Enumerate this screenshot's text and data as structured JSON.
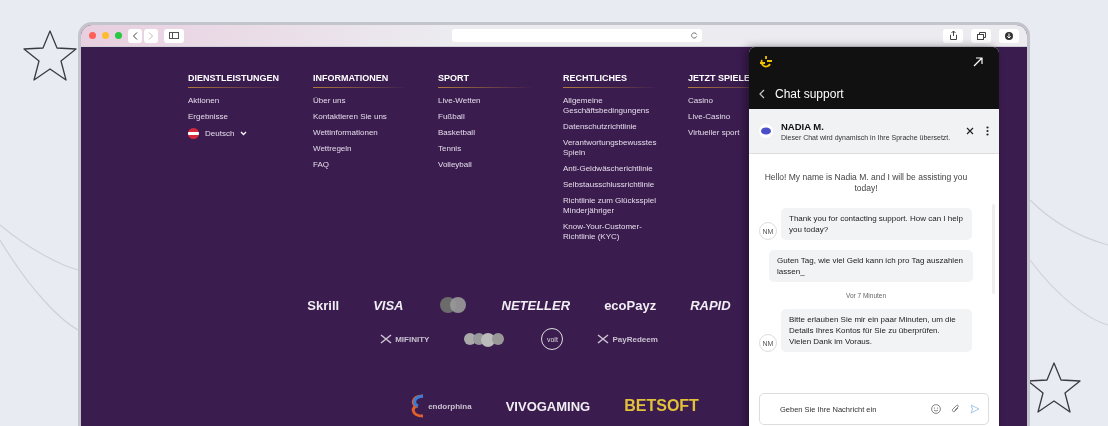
{
  "footer": {
    "columns": [
      {
        "heading": "DIENSTLEISTUNGEN",
        "links": [
          "Aktionen",
          "Ergebnisse"
        ],
        "language": {
          "label": "Deutsch"
        }
      },
      {
        "heading": "INFORMATIONEN",
        "links": [
          "Über uns",
          "Kontaktieren Sie uns",
          "Wettinformationen",
          "Wettregeln",
          "FAQ"
        ]
      },
      {
        "heading": "SPORT",
        "links": [
          "Live-Wetten",
          "Fußball",
          "Basketball",
          "Tennis",
          "Volleyball"
        ]
      },
      {
        "heading": "RECHTLICHES",
        "links": [
          "Allgemeine Geschäftsbedingungens",
          "Datenschutzrichtlinie",
          "Verantwortungsbewusstes Spieln",
          "Anti-Geldwäscherichtlinie",
          "Selbstausschlussrichtlinie",
          "Richtlinie zum Glücksspiel Minderjähriger",
          "Know-Your-Customer-Richtlinie (KYC)"
        ]
      },
      {
        "heading": "JETZT SPIELE",
        "links": [
          "Casino",
          "Live-Casino",
          "Virtueller sport"
        ]
      }
    ],
    "logo_rows": [
      [
        {
          "kind": "wordmark",
          "text": "Skrill"
        },
        {
          "kind": "italic-wordmark",
          "text": "VISA"
        },
        {
          "kind": "circles-mark"
        },
        {
          "kind": "italic-wordmark",
          "text": "NETELLER"
        },
        {
          "kind": "wordmark",
          "text": "ecoPayz"
        },
        {
          "kind": "italic-wordmark",
          "text": "RAPID"
        }
      ],
      [
        {
          "kind": "mark-wordmark",
          "text": "MIFINITY"
        },
        {
          "kind": "coins-mark"
        },
        {
          "kind": "ring-wordmark",
          "text": "volt"
        },
        {
          "kind": "mark-wordmark",
          "text": "PayRedeem"
        }
      ],
      [
        {
          "kind": "swirl-wordmark",
          "text": "endorphina"
        },
        {
          "kind": "wordmark",
          "text": "VIVOGAMING"
        },
        {
          "kind": "gold-wordmark",
          "text": "BETSOFT"
        }
      ]
    ]
  },
  "chat": {
    "title": "Chat support",
    "agent": {
      "name": "NADIA M.",
      "note": "Dieser Chat wird dynamisch in Ihre Sprache übersetzt."
    },
    "messages": [
      {
        "kind": "system",
        "text": "Hello! My name is Nadia M. and I will be assisting you today!"
      },
      {
        "kind": "agent",
        "text": "Thank you for contacting support. How can I help you today?",
        "avatar": "NM"
      },
      {
        "kind": "user",
        "text": "Guten Tag, wie viel Geld kann ich pro Tag auszahlen lassen_"
      },
      {
        "kind": "time",
        "text": "Vor 7 Minuten"
      },
      {
        "kind": "agent",
        "text": "Bitte erlauben Sie mir ein paar Minuten, um die Details Ihres Kontos für Sie zu überprüfen. Vielen Dank im Voraus.",
        "avatar": "NM"
      }
    ],
    "input": {
      "placeholder": "Geben Sie Ihre Nachricht ein"
    }
  }
}
